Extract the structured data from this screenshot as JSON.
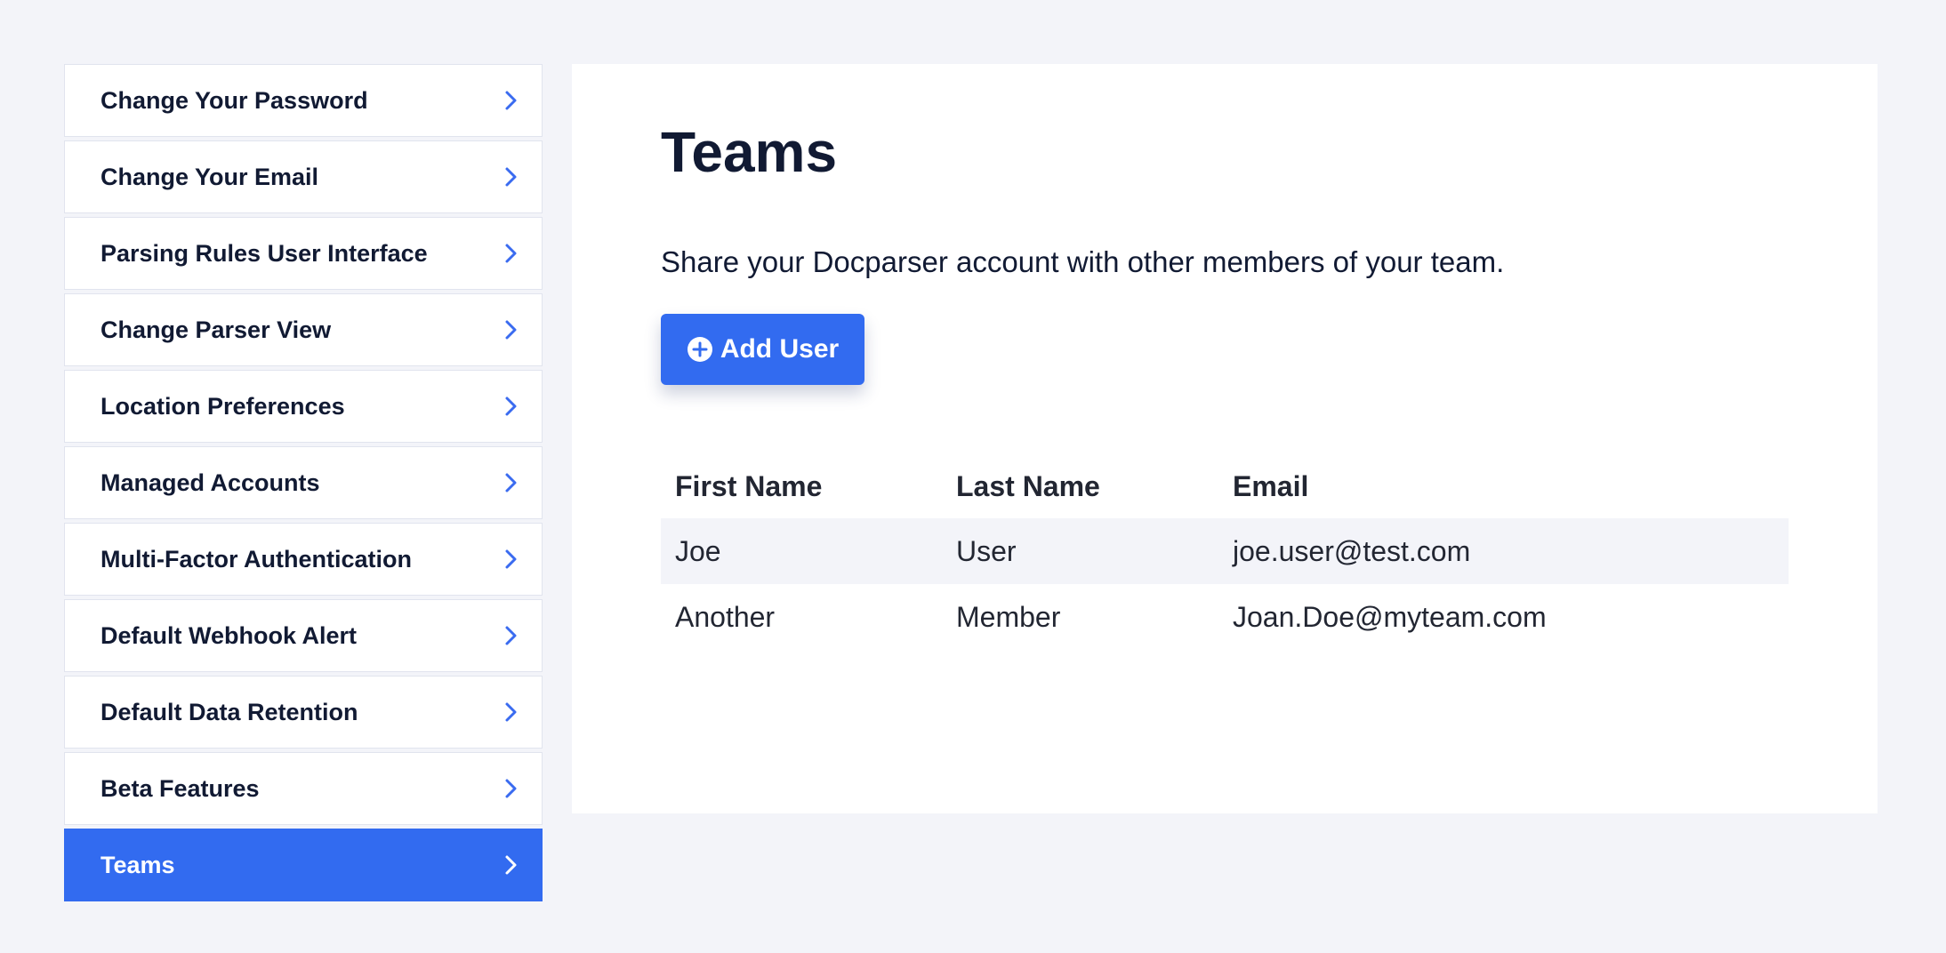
{
  "sidebar": {
    "items": [
      {
        "label": "Change Your Password"
      },
      {
        "label": "Change Your Email"
      },
      {
        "label": "Parsing Rules User Interface"
      },
      {
        "label": "Change Parser View"
      },
      {
        "label": "Location Preferences"
      },
      {
        "label": "Managed Accounts"
      },
      {
        "label": "Multi-Factor Authentication"
      },
      {
        "label": "Default Webhook Alert"
      },
      {
        "label": "Default Data Retention"
      },
      {
        "label": "Beta Features"
      },
      {
        "label": "Teams",
        "active": true
      }
    ],
    "chevron_icon": "chevron-right-icon"
  },
  "main": {
    "title": "Teams",
    "description": "Share your Docparser account with other members of your team.",
    "add_user_label": "Add User",
    "add_user_icon": "plus-circle-icon",
    "table": {
      "headers": [
        "First Name",
        "Last Name",
        "Email"
      ],
      "rows": [
        [
          "Joe",
          "User",
          "joe.user@test.com"
        ],
        [
          "Another",
          "Member",
          "Joan.Doe@myteam.com"
        ]
      ]
    }
  },
  "colors": {
    "accent": "#326bf0",
    "background": "#f3f4f9",
    "text": "#111a33"
  }
}
